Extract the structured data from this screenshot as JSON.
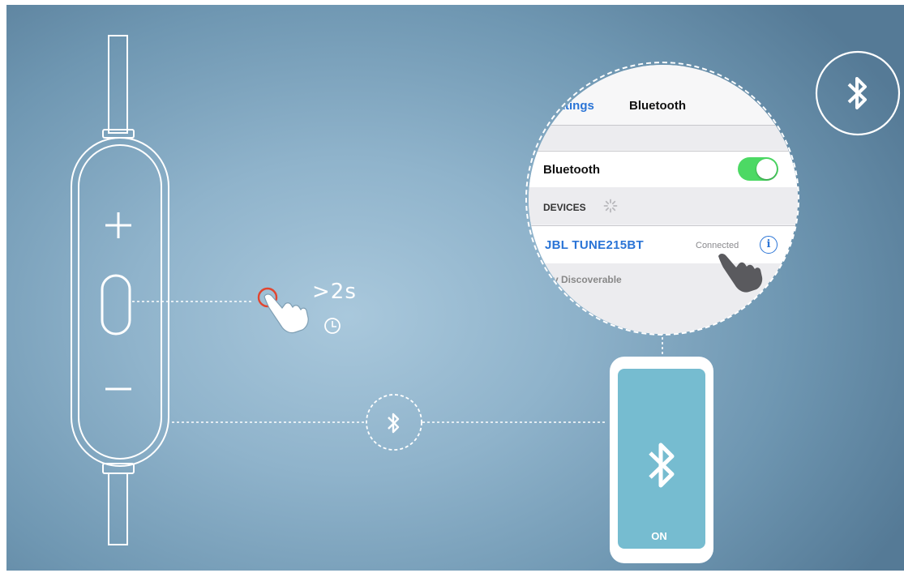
{
  "remote": {
    "plus_label": "+",
    "minus_label": "−",
    "hold_duration": ">2s"
  },
  "settings_zoom": {
    "back_label": "ttings",
    "title": "Bluetooth",
    "bluetooth_row_label": "Bluetooth",
    "bluetooth_toggle_on": true,
    "devices_header": "DEVICES",
    "device_name": "JBL TUNE215BT",
    "device_status": "Connected",
    "info_label": "i",
    "footer_text": "v Discoverable"
  },
  "phone": {
    "status_label": "ON"
  },
  "colors": {
    "background": "#8fb3cb",
    "line": "#ffffff",
    "phone_screen": "#76bcd0",
    "toggle_on": "#4cd964",
    "link_blue": "#2a74d6",
    "press_ring": "#e2452f"
  },
  "icons": [
    "bluetooth-icon",
    "pointing-hand-icon",
    "clock-icon",
    "loading-spinner-icon",
    "info-icon"
  ]
}
